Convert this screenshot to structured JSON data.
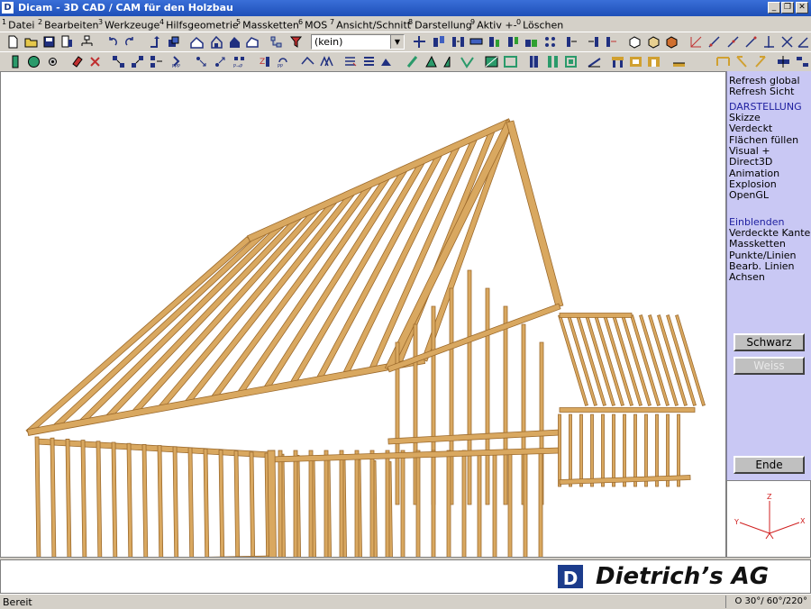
{
  "window": {
    "title": "Dicam - 3D CAD / CAM für den Holzbau",
    "logo_letter": "D",
    "min_glyph": "_",
    "restore_glyph": "❐",
    "close_glyph": "✕"
  },
  "menu": {
    "items": [
      {
        "num": "1",
        "label": "Datei"
      },
      {
        "num": "2",
        "label": "Bearbeiten"
      },
      {
        "num": "3",
        "label": "Werkzeuge"
      },
      {
        "num": "4",
        "label": "Hilfsgeometrie"
      },
      {
        "num": "5",
        "label": "Massketten"
      },
      {
        "num": "6",
        "label": "MOS"
      },
      {
        "num": "7",
        "label": "Ansicht/Schnitt"
      },
      {
        "num": "8",
        "label": "Darstellung"
      },
      {
        "num": "9",
        "label": "Aktiv +-"
      },
      {
        "num": "0",
        "label": "Löschen"
      }
    ]
  },
  "toolbar1": {
    "layer_select_value": "(kein)"
  },
  "right_panel": {
    "refresh_global": "Refresh global",
    "refresh_view": "Refresh Sicht",
    "display_header": "DARSTELLUNG",
    "display_items": [
      "Skizze",
      "Verdeckt",
      "Flächen füllen",
      "Visual +",
      "Direct3D",
      "Animation",
      "Explosion",
      "OpenGL"
    ],
    "show_header": "Einblenden",
    "show_items": [
      "Verdeckte Kanter",
      "Massketten",
      "Punkte/Linien",
      "Bearb. Linien",
      "Achsen"
    ],
    "black_button": "Schwarz",
    "white_button": "Weiss",
    "end_button": "Ende"
  },
  "axes": {
    "x": "X",
    "y": "Y",
    "z": "Z"
  },
  "brand": {
    "logo_letter": "D",
    "name": "Dietrich’s AG"
  },
  "status": {
    "left": "Bereit",
    "right": "O 30°/ 60°/220°"
  },
  "colors": {
    "accent": "#1e4fb8",
    "panel": "#c9c8f4",
    "timber": "#d9a860",
    "timber_dark": "#9c6a2c"
  }
}
